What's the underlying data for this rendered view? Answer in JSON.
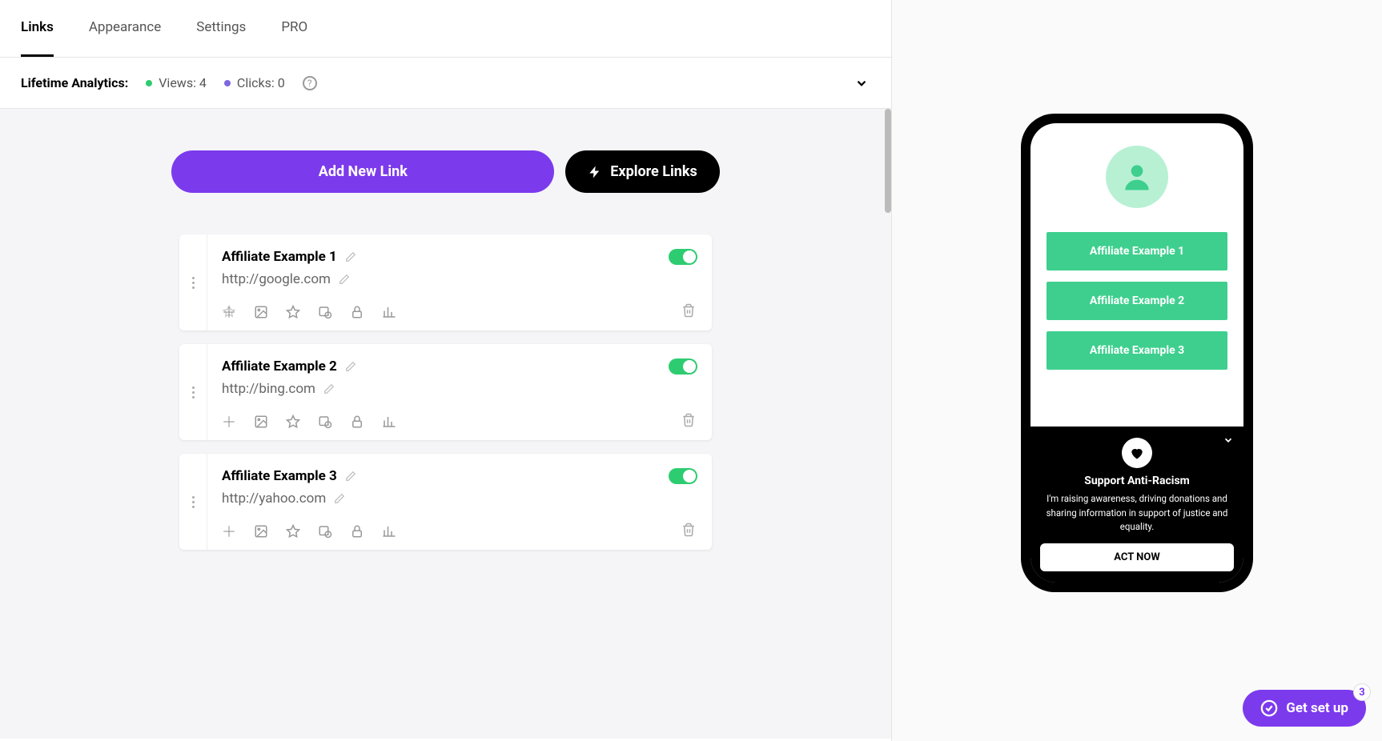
{
  "tabs": [
    {
      "label": "Links",
      "active": true
    },
    {
      "label": "Appearance",
      "active": false
    },
    {
      "label": "Settings",
      "active": false
    },
    {
      "label": "PRO",
      "active": false
    }
  ],
  "analytics": {
    "label": "Lifetime Analytics:",
    "views_label": "Views:",
    "views_count": "4",
    "clicks_label": "Clicks:",
    "clicks_count": "0"
  },
  "buttons": {
    "add": "Add New Link",
    "explore": "Explore Links"
  },
  "links": [
    {
      "title": "Affiliate Example 1",
      "url": "http://google.com",
      "enabled": true
    },
    {
      "title": "Affiliate Example 2",
      "url": "http://bing.com",
      "enabled": true
    },
    {
      "title": "Affiliate Example 3",
      "url": "http://yahoo.com",
      "enabled": true
    }
  ],
  "preview": {
    "links": [
      "Affiliate Example 1",
      "Affiliate Example 2",
      "Affiliate Example 3"
    ],
    "banner": {
      "title": "Support Anti-Racism",
      "text": "I'm raising awareness, driving donations and sharing information in support of justice and equality.",
      "cta": "ACT NOW"
    }
  },
  "setup": {
    "label": "Get set up",
    "badge": "3"
  }
}
